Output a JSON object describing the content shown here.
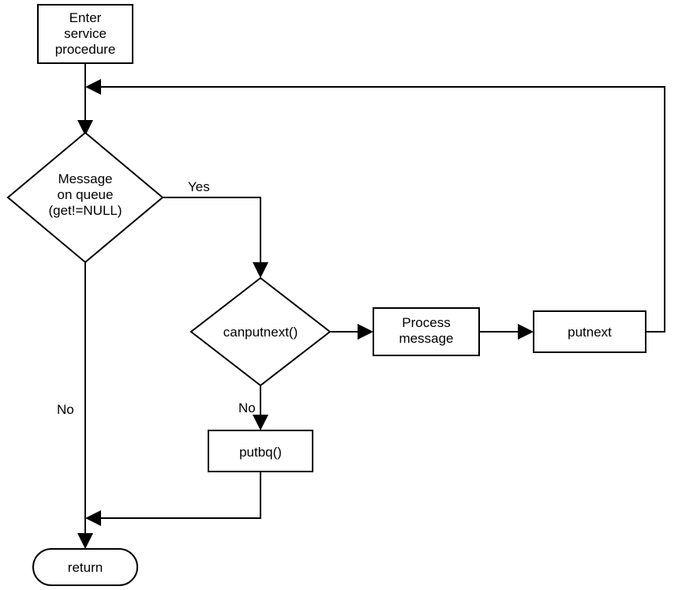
{
  "diagram": {
    "type": "flowchart",
    "nodes": {
      "start": {
        "line1": "Enter",
        "line2": "service",
        "line3": "procedure"
      },
      "decision1": {
        "line1": "Message",
        "line2": "on queue",
        "line3": "(get!=NULL)"
      },
      "decision2": {
        "text": "canputnext()"
      },
      "process": {
        "line1": "Process",
        "line2": "message"
      },
      "putnext": {
        "text": "putnext"
      },
      "putbq": {
        "text": "putbq()"
      },
      "return": {
        "text": "return"
      }
    },
    "edges": {
      "yes1": "Yes",
      "no1": "No",
      "no2": "No"
    }
  }
}
